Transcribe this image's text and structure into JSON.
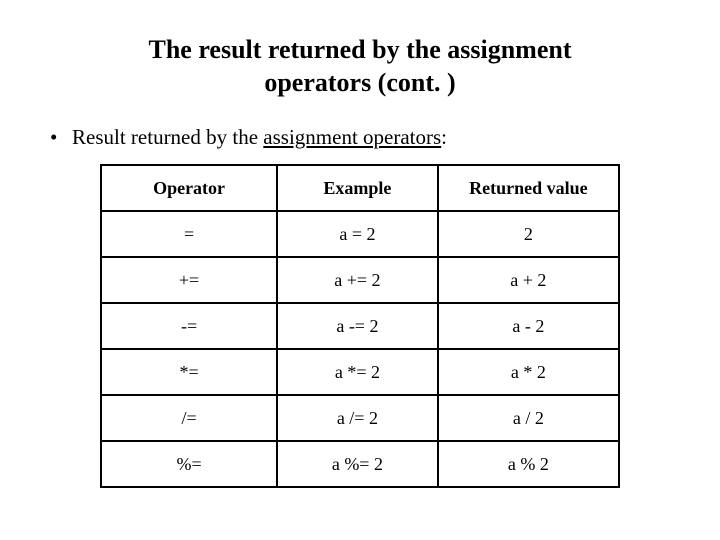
{
  "title": "The result returned by the assignment operators (cont. )",
  "bullet": {
    "lead": "Result returned by the ",
    "underlined": "assignment operators",
    "tail": ":"
  },
  "table": {
    "headers": [
      "Operator",
      "Example",
      "Returned value"
    ],
    "rows": [
      {
        "op": "=",
        "ex": "a = 2",
        "ret": "2"
      },
      {
        "op": "+=",
        "ex": "a += 2",
        "ret": "a + 2"
      },
      {
        "op": "-=",
        "ex": "a -= 2",
        "ret": "a - 2"
      },
      {
        "op": "*=",
        "ex": "a *= 2",
        "ret": "a  * 2"
      },
      {
        "op": "/=",
        "ex": "a /= 2",
        "ret": "a / 2"
      },
      {
        "op": "%=",
        "ex": "a %= 2",
        "ret": "a % 2"
      }
    ]
  },
  "chart_data": {
    "type": "table",
    "title": "The result returned by the assignment operators (cont. )",
    "columns": [
      "Operator",
      "Example",
      "Returned value"
    ],
    "rows": [
      [
        "=",
        "a = 2",
        "2"
      ],
      [
        "+=",
        "a += 2",
        "a + 2"
      ],
      [
        "-=",
        "a -= 2",
        "a - 2"
      ],
      [
        "*=",
        "a *= 2",
        "a  * 2"
      ],
      [
        "/=",
        "a /= 2",
        "a / 2"
      ],
      [
        "%=",
        "a %= 2",
        "a % 2"
      ]
    ]
  }
}
